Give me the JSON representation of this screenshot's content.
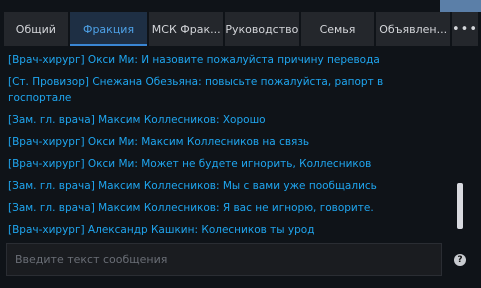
{
  "tabs": [
    {
      "label": "Общий",
      "active": false
    },
    {
      "label": "Фракция",
      "active": true
    },
    {
      "label": "МСК Фрак...",
      "active": false
    },
    {
      "label": "Руководство",
      "active": false
    },
    {
      "label": "Семья",
      "active": false
    },
    {
      "label": "Объявлен...",
      "active": false
    }
  ],
  "more_label": "•••",
  "messages": [
    "[Врач-хирург] Окси Ми: И назовите пожалуйста причину перевода",
    "[Ст. Провизор] Снежана Обезьяна: повысьте пожалуйста, рапорт в госпортале",
    "[Зам. гл. врача] Максим Коллесников: Хорошо",
    "[Врач-хирург] Окси Ми: Максим Коллесников на связь",
    "[Врач-хирург] Окси Ми: Может не будете игнорить, Коллесников",
    "[Зам. гл. врача] Максим Коллесников:  Мы с вами уже пообщались",
    "[Зам. гл. врача] Максим Коллесников: Я вас не игнорю, говорите.",
    "[Врач-хирург] Александр Кашкин: Колесников ты урод"
  ],
  "input": {
    "placeholder": "Введите текст сообщения",
    "value": ""
  },
  "help_label": "?",
  "colors": {
    "message": "#1fa6f0",
    "active_tab": "#4ea2e8",
    "panel": "#0a0c10"
  }
}
